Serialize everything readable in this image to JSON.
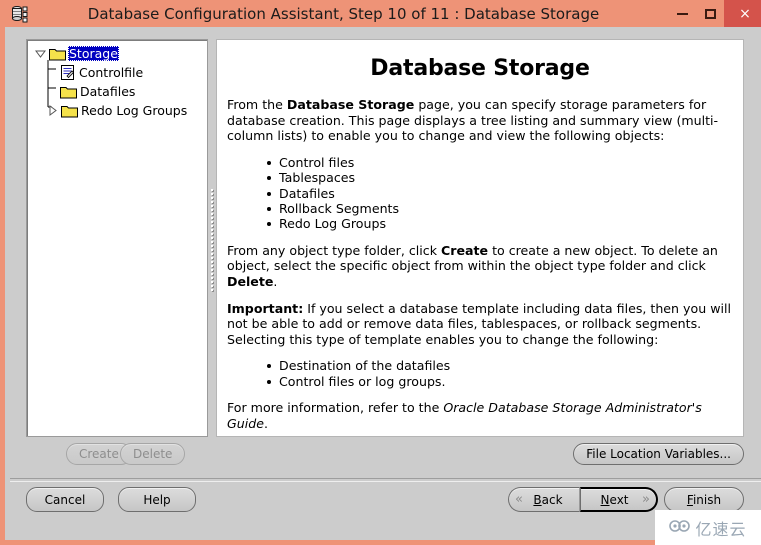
{
  "window": {
    "title": "Database Configuration Assistant, Step 10 of 11 : Database Storage",
    "app_icon": "database-icon",
    "controls": {
      "minimize": "–",
      "maximize": "□",
      "close": "×"
    },
    "colors": {
      "titlebar": "#ee9377",
      "close_button": "#d4534b",
      "dialog_background": "#cccccc",
      "panel_background": "#ffffff",
      "selection": "#0000c0"
    }
  },
  "tree": {
    "nodes": [
      {
        "label": "Storage",
        "icon": "folder-icon",
        "toggle": "collapse-icon",
        "selected": true,
        "level": 0
      },
      {
        "label": "Controlfile",
        "icon": "controlfile-icon",
        "toggle": "none",
        "selected": false,
        "level": 1
      },
      {
        "label": "Datafiles",
        "icon": "folder-icon",
        "toggle": "none",
        "selected": false,
        "level": 1
      },
      {
        "label": "Redo Log Groups",
        "icon": "folder-icon",
        "toggle": "expand-icon",
        "selected": false,
        "level": 1
      }
    ]
  },
  "doc": {
    "title": "Database Storage",
    "para1_a": "From the ",
    "para1_b": "Database Storage",
    "para1_c": " page, you can specify storage parameters for database creation. This page displays a tree listing and summary view (multi-column lists) to enable you to change and view the following objects:",
    "list1": [
      "Control files",
      "Tablespaces",
      "Datafiles",
      "Rollback Segments",
      "Redo Log Groups"
    ],
    "para2_a": "From any object type folder, click ",
    "para2_b": "Create",
    "para2_c": " to create a new object. To delete an object, select the specific object from within the object type folder and click ",
    "para2_d": "Delete",
    "para2_e": ".",
    "para3_a": "Important:",
    "para3_b": " If you select a database template including data files, then you will not be able to add or remove data files, tablespaces, or rollback segments. Selecting this type of template enables you to change the following:",
    "list2": [
      "Destination of the datafiles",
      "Control files or log groups."
    ],
    "para4_a": "For more information, refer to the ",
    "para4_b": "Oracle Database Storage Administrator's Guide",
    "para4_c": "."
  },
  "toolbar": {
    "create_label": "Create",
    "create_enabled": false,
    "delete_label": "Delete",
    "delete_enabled": false,
    "file_location_label": "File Location Variables..."
  },
  "nav": {
    "cancel_label": "Cancel",
    "help_label": "Help",
    "back_label": "Back",
    "back_mnemonic": "B",
    "back_arrow": "«",
    "next_label": "Next",
    "next_mnemonic": "N",
    "next_arrow": "»",
    "next_focused": true,
    "finish_label": "Finish",
    "finish_mnemonic": "F"
  },
  "watermark": {
    "text": "亿速云",
    "logo": "cloud-logo-icon"
  }
}
